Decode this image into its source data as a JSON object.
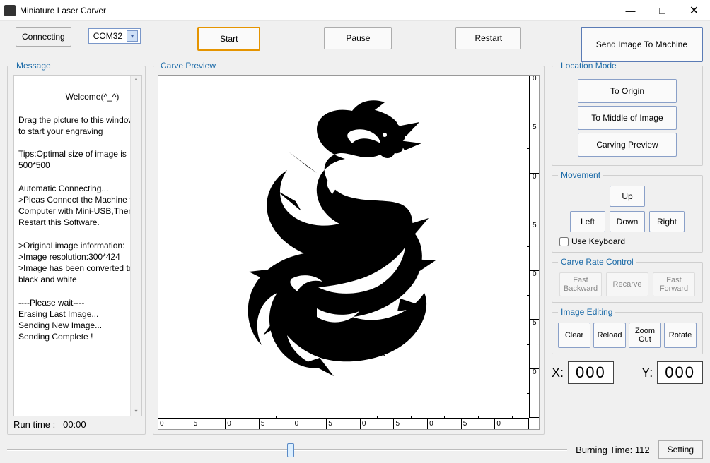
{
  "window": {
    "title": "Miniature Laser Carver",
    "minimize": "—",
    "maximize": "□",
    "close": "✕"
  },
  "toolbar": {
    "connecting": "Connecting",
    "port": "COM32",
    "start": "Start",
    "pause": "Pause",
    "restart": "Restart",
    "send": "Send Image To Machine"
  },
  "message": {
    "legend": "Message",
    "text": "          Welcome(^_^)\n\nDrag the picture to this window to start your engraving\n\nTips:Optimal size of image is 500*500\n\nAutomatic Connecting...\n>Pleas Connect the Machine to Computer with Mini-USB,Then Restart this Software.\n\n>Original image information:\n>Image resolution:300*424\n>Image has been converted to black and white\n\n----Please wait----\nErasing Last Image...\nSending New Image...\nSending Complete !",
    "runtime_label": "Run time :",
    "runtime_value": "00:00"
  },
  "preview": {
    "legend": "Carve Preview",
    "ruler_marks": [
      "0",
      "5",
      "0",
      "5",
      "0",
      "5",
      "0",
      "5",
      "0",
      "5",
      "0"
    ],
    "ruler_v": [
      "0",
      "5",
      "0",
      "5",
      "0",
      "5",
      "0"
    ]
  },
  "location": {
    "legend": "Location Mode",
    "origin": "To Origin",
    "middle": "To Middle of Image",
    "preview": "Carving Preview"
  },
  "movement": {
    "legend": "Movement",
    "up": "Up",
    "left": "Left",
    "down": "Down",
    "right": "Right",
    "use_keyboard": "Use Keyboard"
  },
  "rate": {
    "legend": "Carve Rate Control",
    "fb": "Fast Backward",
    "recarve": "Recarve",
    "ff": "Fast Forward"
  },
  "edit": {
    "legend": "Image Editing",
    "clear": "Clear",
    "reload": "Reload",
    "zoom": "Zoom Out",
    "rotate": "Rotate"
  },
  "coords": {
    "x_label": "X:",
    "x_value": "000",
    "y_label": "Y:",
    "y_value": "000"
  },
  "bottom": {
    "burning_label": "Burning Time:",
    "burning_value": "112",
    "setting": "Setting"
  }
}
